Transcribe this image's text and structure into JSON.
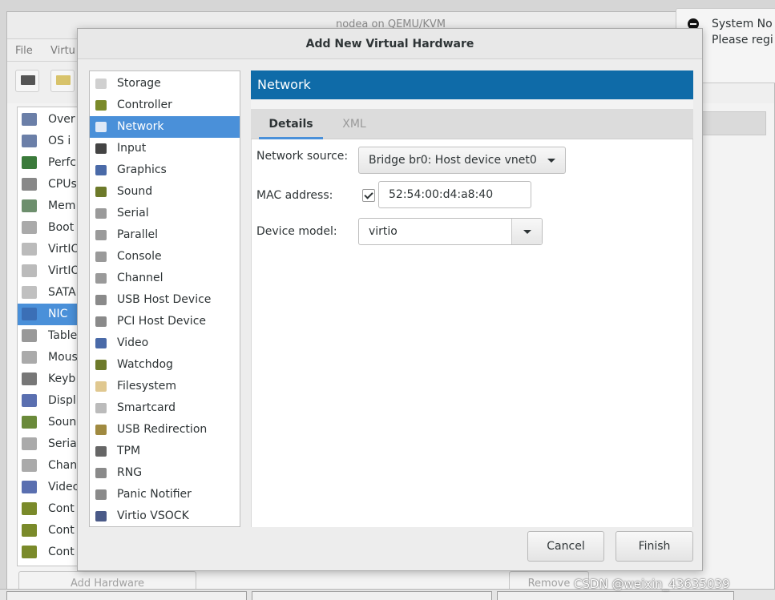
{
  "background_window": {
    "title": "nodea on QEMU/KVM",
    "menu": [
      "File",
      "Virtu"
    ],
    "items": [
      "Over",
      "OS i",
      "Perfc",
      "CPUs",
      "Mem",
      "Boot",
      "VirtIO",
      "VirtIO",
      "SATA",
      "NIC",
      "Table",
      "Mous",
      "Keyb",
      "Displ",
      "Soun",
      "Seria",
      "Chan",
      "Videc",
      "Cont",
      "Cont",
      "Cont"
    ],
    "selected_item": "NIC",
    "add_hardware_label": "Add Hardware",
    "remove_label": "Remove"
  },
  "notification": {
    "title": "System No",
    "body": "Please regi"
  },
  "dialog": {
    "title": "Add New Virtual Hardware",
    "hardware_types": [
      {
        "label": "Storage",
        "icon": "disk-icon"
      },
      {
        "label": "Controller",
        "icon": "controller-icon"
      },
      {
        "label": "Network",
        "icon": "network-icon"
      },
      {
        "label": "Input",
        "icon": "mouse-icon"
      },
      {
        "label": "Graphics",
        "icon": "monitor-icon"
      },
      {
        "label": "Sound",
        "icon": "sound-card-icon"
      },
      {
        "label": "Serial",
        "icon": "serial-port-icon"
      },
      {
        "label": "Parallel",
        "icon": "parallel-port-icon"
      },
      {
        "label": "Console",
        "icon": "console-port-icon"
      },
      {
        "label": "Channel",
        "icon": "channel-port-icon"
      },
      {
        "label": "USB Host Device",
        "icon": "usb-device-icon"
      },
      {
        "label": "PCI Host Device",
        "icon": "pci-device-icon"
      },
      {
        "label": "Video",
        "icon": "video-monitor-icon"
      },
      {
        "label": "Watchdog",
        "icon": "watchdog-icon"
      },
      {
        "label": "Filesystem",
        "icon": "folder-icon"
      },
      {
        "label": "Smartcard",
        "icon": "smartcard-icon"
      },
      {
        "label": "USB Redirection",
        "icon": "usb-redirection-icon"
      },
      {
        "label": "TPM",
        "icon": "tpm-chip-icon"
      },
      {
        "label": "RNG",
        "icon": "rng-icon"
      },
      {
        "label": "Panic Notifier",
        "icon": "panic-notifier-icon"
      },
      {
        "label": "Virtio VSOCK",
        "icon": "vsock-icon"
      }
    ],
    "selected_type": "Network",
    "section_header": "Network",
    "tabs": {
      "details": "Details",
      "xml": "XML"
    },
    "form": {
      "network_source_label": "Network source:",
      "network_source_value": "Bridge br0: Host device vnet0",
      "mac_address_label": "MAC address:",
      "mac_address_checked": true,
      "mac_address_value": "52:54:00:d4:a8:40",
      "device_model_label": "Device model:",
      "device_model_value": "virtio"
    },
    "buttons": {
      "cancel": "Cancel",
      "finish": "Finish"
    }
  },
  "taskbar": {
    "tasks": [
      "",
      "",
      ""
    ]
  },
  "watermark": "CSDN @weixin_43635039",
  "colors": {
    "selection": "#4a90d9",
    "section_header": "#0f6ba8"
  }
}
